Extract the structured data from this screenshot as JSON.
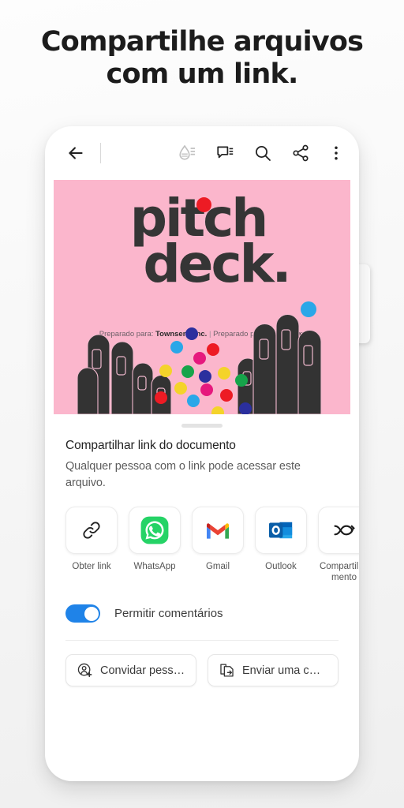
{
  "headline": {
    "line1": "Compartilhe arquivos",
    "line2": "com um link."
  },
  "toolbar": {
    "back_icon": "arrow-left-icon",
    "highlight_icon": "liquid-mode-icon",
    "comment_icon": "comment-icon",
    "search_icon": "search-icon",
    "share_icon": "share-icon",
    "overflow_icon": "more-vertical-icon"
  },
  "document": {
    "title_line1": "pitch",
    "title_line2": "deck.",
    "credit_prepared_for_label": "Preparado para:",
    "credit_prepared_for_value": "Townsend Inc.",
    "credit_separator": "|",
    "credit_prepared_by_label": "Preparado por:",
    "credit_prepared_by_value": "Stella Sanz",
    "slide_background": "#fbb6cc",
    "accent_red": "#ed1b24",
    "accent_blue": "#2aa7e8"
  },
  "sheet": {
    "drag_handle": "drag-handle",
    "title": "Compartilhar link do documento",
    "subtitle": "Qualquer pessoa com o link pode acessar este arquivo.",
    "targets": [
      {
        "label": "Obter link",
        "icon": "link-icon"
      },
      {
        "label": "WhatsApp",
        "icon": "whatsapp-icon"
      },
      {
        "label": "Gmail",
        "icon": "gmail-icon"
      },
      {
        "label": "Outlook",
        "icon": "outlook-icon"
      },
      {
        "label": "Compartilhamento",
        "icon": "nearby-share-icon"
      }
    ],
    "toggle": {
      "label": "Permitir comentários",
      "enabled": true,
      "accent": "#1f83e8"
    },
    "actions": [
      {
        "label": "Convidar pess…",
        "icon": "person-add-icon"
      },
      {
        "label": "Enviar uma c…",
        "icon": "send-copy-icon"
      }
    ]
  }
}
